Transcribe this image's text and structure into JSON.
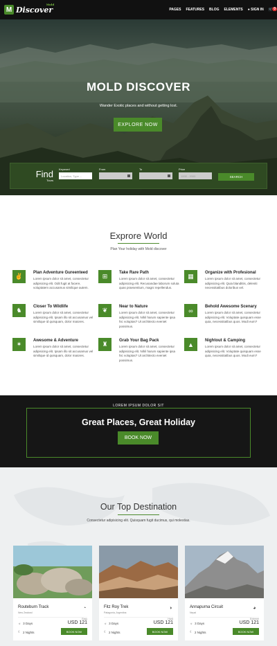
{
  "nav": {
    "logo_mark": "M",
    "logo_text": "Discover",
    "logo_sub": "Mold",
    "items": [
      "PAGES",
      "FEATURES",
      "BLOG",
      "ELEMENTS"
    ],
    "signin": "SIGN IN",
    "cart_count": "0"
  },
  "hero": {
    "title": "MOLD DISCOVER",
    "subtitle": "Wander Exotic places and without getting lost.",
    "button": "EXPLORE NOW"
  },
  "search": {
    "find": "Find",
    "find_sub": "Tours",
    "keyword_label": "Keyword",
    "keyword_placeholder": "Location, Type ...",
    "from_label": "From",
    "to_label": "To",
    "price_label": "Price",
    "price_value": "1000 - 2000",
    "button": "SEARCH"
  },
  "explore": {
    "title": "Exprore World",
    "subtitle": "Plan Your holiday with Mold discover",
    "features": [
      {
        "icon": "peace-icon",
        "glyph": "✌",
        "title": "Plan Adventure Gureenteed",
        "text": "Lorem ipsum dolor sit amet, consectetur adipisicing elit. Odit fugit at facere, voluptatem accusamus similique autem."
      },
      {
        "icon": "signpost-icon",
        "glyph": "⊞",
        "title": "Take Rare Path",
        "text": "Lorem ipsum dolor sit amet, consectetur adipisicing elit. Recusandae laborum soluta quas praesentium, magni repellendus."
      },
      {
        "icon": "map-icon",
        "glyph": "▦",
        "title": "Organize with Profesional",
        "text": "Lorem ipsum dolor sit amet, consectetur adipisicing elit. Quia blanditiis, deleniti necessitatibus doloribus vel."
      },
      {
        "icon": "deer-icon",
        "glyph": "♞",
        "title": "Closer To Wildlife",
        "text": "Lorem ipsum dolor sit amet, consectetur adipisicing elit. Ipsam illo sit accusamus vel similique id quisquam, dolor maiores."
      },
      {
        "icon": "leaf-icon",
        "glyph": "❦",
        "title": "Near to Nature",
        "text": "Lorem ipsum dolor sit amet, consectetur adipisicing elit. Nihil harum sapiente ipsa hic voluptas? Ut architecto eveniet possimus."
      },
      {
        "icon": "binoculars-icon",
        "glyph": "∞",
        "title": "Behold Awesome Scenary",
        "text": "Lorem ipsum dolor sit amet, consectetur adipisicing elit. Voluptate quisquam esse quia, necessitatibus quos. Modi eum?"
      },
      {
        "icon": "hiker-icon",
        "glyph": "✶",
        "title": "Awesome & Adventure",
        "text": "Lorem ipsum dolor sit amet, consectetur adipisicing elit. Ipsam illo sit accusamus vel similique id quisquam, dolor maiores."
      },
      {
        "icon": "backpack-icon",
        "glyph": "♜",
        "title": "Grab Your Bag Pack",
        "text": "Lorem ipsum dolor sit amet, consectetur adipisicing elit. Nihil harum sapiente ipsa hic voluptas? Ut architecto eveniet possimus."
      },
      {
        "icon": "tent-icon",
        "glyph": "▲",
        "title": "Nightout & Camping",
        "text": "Lorem ipsum dolor sit amet, consectetur adipisicing elit. Voluptate quisquam esse quia, necessitatibus quos. Modi eum?"
      }
    ]
  },
  "banner": {
    "small": "LOREM IPSUM DOLOR SIT",
    "title": "Great Places, Great Holiday",
    "button": "BOOK NOW"
  },
  "destinations": {
    "title": "Our Top Destination",
    "subtitle": "Consectetur adipisicing elit. Quisquam fugit ducimus, qui molestias.",
    "cards": [
      {
        "name": "Routeburn Track",
        "location": "New Zealand",
        "level": "Easy",
        "days": "3 Days",
        "nights": "2 Nights",
        "price": "USD 121",
        "button": "BOOK NOW"
      },
      {
        "name": "Fitz Roy Trek",
        "location": "Patagonia, Argentina",
        "level": "Hard",
        "days": "3 Days",
        "nights": "2 Nights",
        "price": "USD 121",
        "button": "BOOK NOW"
      },
      {
        "name": "Annapurna Circuit",
        "location": "Nepal",
        "level": "Extreme",
        "days": "3 Days",
        "nights": "2 Nights",
        "price": "USD 121",
        "button": "BOOK NOW"
      }
    ]
  },
  "colors": {
    "accent": "#4a8a2a",
    "dark": "#161616"
  }
}
